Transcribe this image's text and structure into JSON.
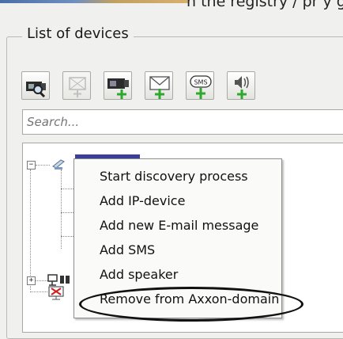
{
  "header": {
    "partial_text": "n the registry / pr y g"
  },
  "devices_panel": {
    "title": "List of devices",
    "search": {
      "placeholder": "Search...",
      "value": ""
    }
  },
  "toolbar": {
    "buttons": [
      {
        "name": "search-camera",
        "icon": "camera-magnifier-icon"
      },
      {
        "name": "add-disabled",
        "icon": "add-device-disabled-icon",
        "enabled": false
      },
      {
        "name": "add-camera",
        "icon": "camera-plus-icon"
      },
      {
        "name": "add-email",
        "icon": "envelope-plus-icon"
      },
      {
        "name": "add-sms",
        "icon": "sms-plus-icon"
      },
      {
        "name": "add-speaker",
        "icon": "speaker-plus-icon"
      }
    ]
  },
  "context_menu": {
    "items": [
      "Start discovery process",
      "Add IP-device",
      "Add new E-mail message",
      "Add SMS",
      "Add speaker",
      "Remove from Axxon-domain"
    ],
    "highlighted": "Remove from Axxon-domain"
  },
  "colors": {
    "accent_selection": "#3b3d9a",
    "plus_green": "#2fa82f",
    "background": "#f0f0ee"
  }
}
